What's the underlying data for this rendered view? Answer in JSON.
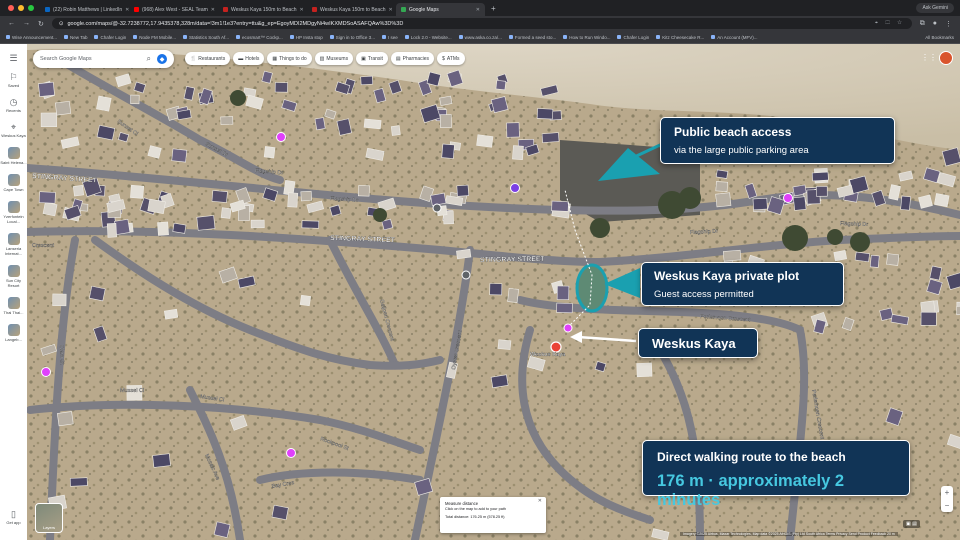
{
  "browser": {
    "tabs": [
      {
        "label": "(22) Robin Matthews | LinkedIn",
        "active": false,
        "color": "#0a66c2"
      },
      {
        "label": "(968) Alex West - SEAL Team",
        "active": false,
        "color": "#ff0000"
      },
      {
        "label": "Weskus Kaya 150m to Beach",
        "active": false,
        "color": "#c5221f"
      },
      {
        "label": "Weskus Kaya 150m to Beach",
        "active": false,
        "color": "#c5221f"
      },
      {
        "label": "Google Maps",
        "active": true,
        "color": "#34a853"
      }
    ],
    "new_tab": "+",
    "ask_gemini": "Ask Gemini",
    "url": "google.com/maps/@-32.7238772,17.9435378,328m/data=!3m1!1e3?entry=ttu&g_ep=EgoyMDI2MDgyNi4wIKXMDSoASAFQAw%3D%3D",
    "bookmarks": [
      "Wise Announcement...",
      "New Tab",
      "Chafer Login",
      "Node FM Mobile...",
      "Statistics South Af...",
      "ecosmart™ Cockp...",
      "HP Insta stop",
      "Sign in to Office 3...",
      "I see",
      "Lock 2.0 - Website...",
      "www.aska.co.za/...",
      "Formed a seed sto...",
      "How to Run Windo...",
      "Chafer Login",
      "Kitz Cheesecake R...",
      "An Account (MFV)..."
    ],
    "all_bookmarks": "All Bookmarks"
  },
  "rail": {
    "items": [
      {
        "label": "Saved",
        "icon": "bookmark-icon"
      },
      {
        "label": "Recents",
        "icon": "history-icon"
      },
      {
        "label": "Weskus Kaya",
        "icon": "pin-icon"
      },
      {
        "label": "Saint Helena...",
        "icon": "place-thumb"
      },
      {
        "label": "Cape Town",
        "icon": "place-thumb"
      },
      {
        "label": "Yzerfontein Local...",
        "icon": "place-thumb"
      },
      {
        "label": "Lanseria Internat...",
        "icon": "place-thumb"
      },
      {
        "label": "Sun City Resort",
        "icon": "place-thumb"
      },
      {
        "label": "Thai Thai...",
        "icon": "place-thumb"
      },
      {
        "label": "Langeb...",
        "icon": "place-thumb"
      }
    ],
    "get_app": "Get app"
  },
  "search": {
    "placeholder": "Search Google Maps"
  },
  "chips": [
    {
      "label": "Restaurants",
      "icon": "🍴"
    },
    {
      "label": "Hotels",
      "icon": "▬"
    },
    {
      "label": "Things to do",
      "icon": "▦"
    },
    {
      "label": "Museums",
      "icon": "▥"
    },
    {
      "label": "Transit",
      "icon": "▣"
    },
    {
      "label": "Pharmacies",
      "icon": "▤"
    },
    {
      "label": "ATMs",
      "icon": "$"
    }
  ],
  "map": {
    "streets": [
      "STINGRAY STREET",
      "STINGRAY STREET",
      "STINGRAY STREET",
      "Flagship Dr",
      "Flagship Dr",
      "Flagship Dr",
      "Flagship Dr",
      "Sunset Cl",
      "Sunset Dr",
      "Crescent",
      "Perlemoen Crescent",
      "Perlemoen Crescent",
      "Galjoen Crescent",
      "Mussel Cl",
      "Mussel Cl",
      "Clam St",
      "Oyster Crescent",
      "Bay Cres",
      "Mosaic Ave",
      "Rockpool St"
    ],
    "place_label": "Weskus Kaya"
  },
  "callouts": {
    "beach": {
      "title": "Public beach access",
      "subtitle": "via the large public parking area"
    },
    "plot": {
      "title": "Weskus Kaya private plot",
      "subtitle": "Guest access permitted"
    },
    "house": {
      "title": "Weskus Kaya"
    },
    "route": {
      "title": "Direct walking route to the beach",
      "distance": "176 m · approximately 2 minutes"
    }
  },
  "measure": {
    "title": "Measure distance",
    "hint": "Click on the map to add to your path",
    "total": "Total distance: 176.25 m (578.25 ft)"
  },
  "layers_label": "Layers",
  "attribution": "Imagery ©2025 Airbus, Maxar Technologies, Map data ©2025 AfriGIS (Pty) Ltd   South Africa   Terms   Privacy   Send Product Feedback   20 m",
  "colors": {
    "callout_bg": "#113456",
    "accent": "#46c8e0",
    "arrow": "#1aa0b0",
    "road": "#7d7d85"
  }
}
